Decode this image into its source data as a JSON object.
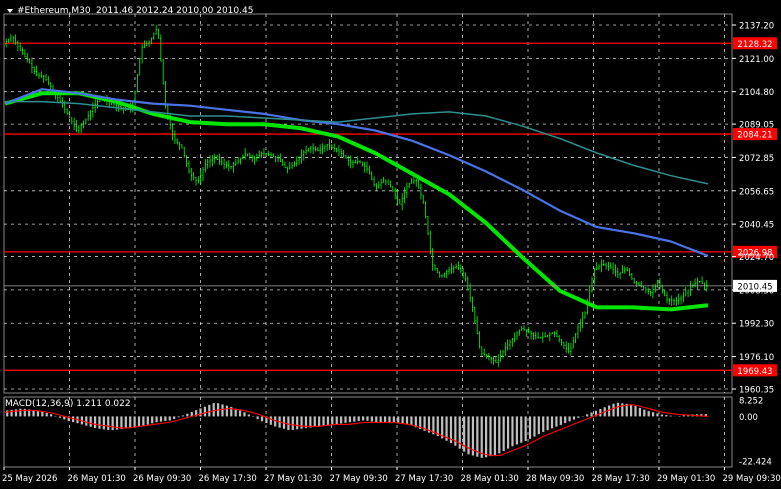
{
  "window": {
    "symbol": "#Ethereum",
    "timeframe": "M30",
    "title": "#Ethereum,M30",
    "ohlc": "2011.46 2012.24 2010.00 2010.45"
  },
  "colors": {
    "background": "#000000",
    "grid": "#ffffff",
    "bull": "#00ff00",
    "bear": "#00ff00",
    "ma_green": "#00e600",
    "ma_blue": "#4a73e8",
    "ma_teal": "#2f8f8f",
    "level_line": "#ff0000",
    "macd_hist": "#c0c0c0",
    "macd_signal": "#ff0000",
    "axis_text": "#ffffff"
  },
  "price_axis": {
    "ticks": [
      "2137.20",
      "2121.00",
      "2104.80",
      "2089.05",
      "2072.85",
      "2056.65",
      "2040.45",
      "2024.70",
      "2008.50",
      "1992.30",
      "1976.10",
      "1960.35"
    ],
    "min": 1960.35,
    "max": 2137.2,
    "current_price": "2010.45"
  },
  "levels": [
    {
      "label": "2128.32",
      "value": 2128.32
    },
    {
      "label": "2084.21",
      "value": 2084.21
    },
    {
      "label": "2026.98",
      "value": 2026.98
    },
    {
      "label": "1969.43",
      "value": 1969.43
    }
  ],
  "time_axis": {
    "labels": [
      "25 May 2026",
      "26 May 01:30",
      "26 May 09:30",
      "26 May 17:30",
      "27 May 01:30",
      "27 May 09:30",
      "27 May 17:30",
      "28 May 01:30",
      "28 May 09:30",
      "28 May 17:30",
      "29 May 01:30",
      "29 May 09:30"
    ]
  },
  "macd": {
    "label": "MACD(12,36,9) 1.211 0.022",
    "ticks": [
      "8.252",
      "0.00",
      "-22.424"
    ],
    "min": -22.424,
    "max": 8.252
  },
  "chart_data": {
    "type": "candlestick",
    "title": "#Ethereum,M30",
    "ylim": [
      1960.35,
      2137.2
    ],
    "x": [
      "25 May 2026",
      "26 May 01:30",
      "26 May 09:30",
      "26 May 17:30",
      "27 May 01:30",
      "27 May 09:30",
      "27 May 17:30",
      "28 May 01:30",
      "28 May 09:30",
      "28 May 17:30",
      "29 May 01:30",
      "29 May 09:30"
    ],
    "price_path": [
      2128,
      2132,
      2125,
      2120,
      2113,
      2112,
      2106,
      2100,
      2093,
      2086,
      2090,
      2097,
      2102,
      2100,
      2098,
      2096,
      2098,
      2126,
      2129,
      2136,
      2098,
      2082,
      2078,
      2065,
      2061,
      2070,
      2073,
      2070,
      2068,
      2071,
      2075,
      2072,
      2075,
      2074,
      2072,
      2067,
      2070,
      2075,
      2078,
      2076,
      2079,
      2077,
      2074,
      2070,
      2071,
      2067,
      2058,
      2062,
      2058,
      2050,
      2060,
      2062,
      2050,
      2021,
      2015,
      2018,
      2020,
      2016,
      2000,
      1978,
      1976,
      1973,
      1980,
      1985,
      1990,
      1988,
      1985,
      1986,
      1988,
      1983,
      1978,
      1990,
      1998,
      2018,
      2021,
      2020,
      2016,
      2019,
      2012,
      2010,
      2007,
      2012,
      2004,
      2003,
      2005,
      2010,
      2013,
      2010
    ],
    "series": [
      {
        "name": "MA green",
        "values": [
          2100,
          2100,
          2099,
          2097,
          2095,
          2093,
          2093,
          2092,
          2091,
          2090,
          2092,
          2094,
          2095,
          2093,
          2088,
          2082,
          2075,
          2069,
          2064,
          2060
        ]
      },
      {
        "name": "MA blue",
        "values": [
          2099,
          2106,
          2104,
          2101,
          2099,
          2098,
          2096,
          2094,
          2091,
          2089,
          2086,
          2081,
          2074,
          2066,
          2057,
          2047,
          2039,
          2036,
          2032,
          2025
        ]
      },
      {
        "name": "MA teal",
        "values": [
          2099,
          2104,
          2104,
          2100,
          2094,
          2090,
          2089,
          2089,
          2087,
          2083,
          2075,
          2065,
          2055,
          2041,
          2024,
          2008,
          2000,
          2000,
          1999,
          2001
        ]
      }
    ],
    "horizontal_levels": [
      2128.32,
      2084.21,
      2026.98,
      1969.43
    ],
    "macd": {
      "ylim": [
        -22.424,
        8.252
      ],
      "histogram": [
        3,
        4,
        3,
        1,
        -2,
        -4,
        -6,
        -7,
        -6,
        -5,
        -3,
        -2,
        1,
        4,
        7,
        5,
        2,
        -2,
        -5,
        -7,
        -6,
        -5,
        -4,
        -3,
        -2,
        -3,
        -3,
        -4,
        -7,
        -10,
        -14,
        -19,
        -21,
        -19,
        -15,
        -12,
        -8,
        -5,
        -2,
        1,
        4,
        7,
        6,
        3,
        1,
        0,
        1,
        1.2
      ],
      "signal": [
        2,
        3,
        3,
        2,
        0,
        -2,
        -4,
        -5,
        -6,
        -5,
        -4,
        -3,
        -1,
        1,
        3,
        4,
        3,
        1,
        -2,
        -4,
        -5,
        -5,
        -4,
        -4,
        -3,
        -3,
        -3,
        -4,
        -6,
        -9,
        -12,
        -16,
        -19,
        -20,
        -17,
        -14,
        -10,
        -7,
        -4,
        -1,
        2,
        5,
        6,
        4,
        2,
        1,
        0.5,
        0.02
      ]
    }
  }
}
